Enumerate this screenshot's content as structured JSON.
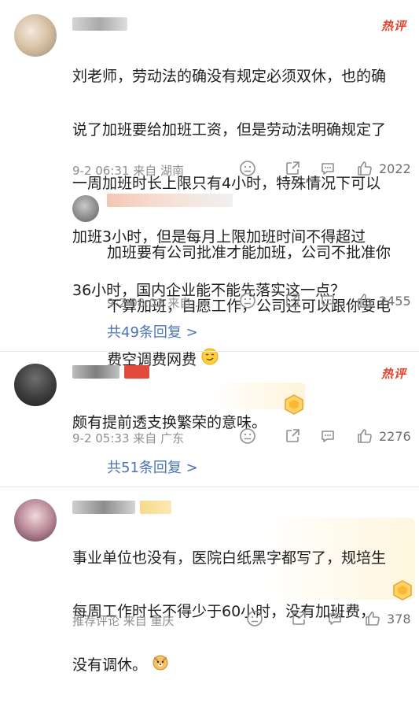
{
  "comments": [
    {
      "hot_label": "热评",
      "text_lines": [
        "刘老师，劳动法的确没有规定必须双休，也的确",
        "说了加班要给加班工资，但是劳动法明确规定了",
        "一周加班时长上限只有4小时，特殊情况下可以",
        "加班3小时，但是每月上限加班时间不得超过",
        "36小时，国内企业能不能先落实这一点？"
      ],
      "meta": "9-2 06:31  来自 湖南",
      "likes": "2022",
      "reply": {
        "text_lines": [
          "加班要有公司批准才能加班，公司不批准你",
          "不算加班，自愿工作，公司还可以跟你要电",
          "费空调费网费"
        ],
        "meta": "9-2 08:02  来自...",
        "likes": "2455"
      },
      "more_replies": "共49条回复 >"
    },
    {
      "hot_label": "热评",
      "text_lines": [
        "颇有提前透支换繁荣的意味。"
      ],
      "meta": "9-2 05:33  来自 广东",
      "likes": "2276",
      "more_replies": "共51条回复 >"
    },
    {
      "text_lines": [
        "事业单位也没有，医院白纸黑字都写了，规培生",
        "每周工作时长不得少于60小时，没有加班费，",
        "没有调休。"
      ],
      "meta": "推荐评论  来自 重庆",
      "likes": "378"
    }
  ],
  "colors": {
    "hot": "#e8412c",
    "link": "#4a74b5",
    "meta": "#8f8f8f"
  }
}
